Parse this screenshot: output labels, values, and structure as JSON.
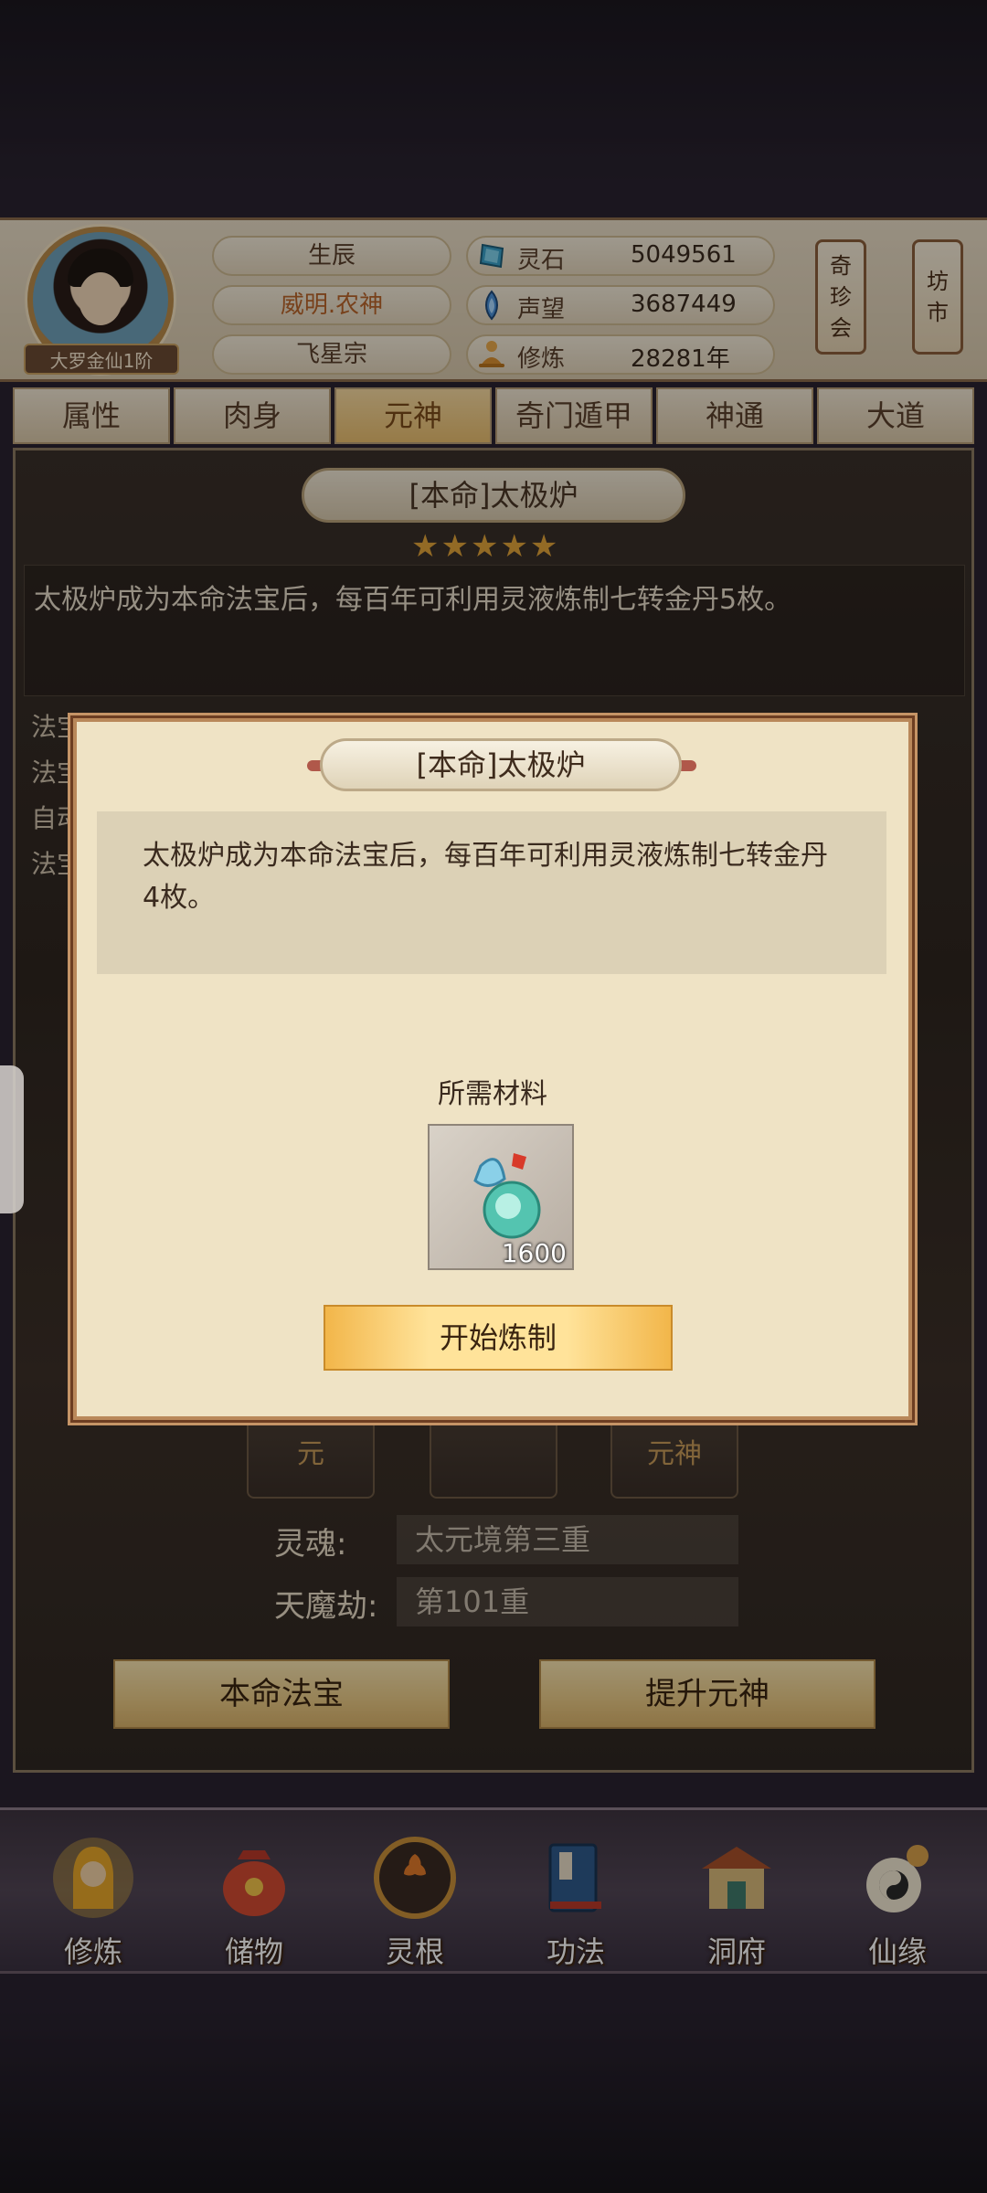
{
  "header": {
    "rank_badge": "大罗金仙1阶",
    "birth_label": "生辰",
    "title_name": "威明.农神",
    "sect": "飞星宗",
    "stats": [
      {
        "icon": "spirit-stone-icon",
        "label": "灵石",
        "value": "5049561"
      },
      {
        "icon": "reputation-icon",
        "label": "声望",
        "value": "3687449"
      },
      {
        "icon": "cultivation-icon",
        "label": "修炼",
        "value": "28281年"
      }
    ],
    "side_buttons": [
      {
        "label_lines": [
          "奇",
          "珍",
          "会"
        ]
      },
      {
        "label_lines": [
          "坊",
          "市"
        ]
      }
    ]
  },
  "tabs": [
    {
      "label": "属性",
      "active": false
    },
    {
      "label": "肉身",
      "active": false
    },
    {
      "label": "元神",
      "active": true
    },
    {
      "label": "奇门遁甲",
      "active": false
    },
    {
      "label": "神通",
      "active": false
    },
    {
      "label": "大道",
      "active": false
    }
  ],
  "background_panel": {
    "title": "[本命]太极炉",
    "stars": "★★★★★",
    "description": "太极炉成为本命法宝后，每百年可利用灵液炼制七转金丹5枚。",
    "left_texts": [
      "法宝成长 1/5000",
      "法宝",
      "自动",
      "法宝"
    ],
    "item_slots": [
      "元",
      "",
      "元神"
    ],
    "rows": [
      {
        "label": "灵魂:",
        "value": "太元境第三重"
      },
      {
        "label": "天魔劫:",
        "value": "第101重"
      }
    ],
    "buttons": [
      "本命法宝",
      "提升元神"
    ]
  },
  "modal": {
    "title": "[本命]太极炉",
    "description": "太极炉成为本命法宝后，每百年可利用灵液炼制七转金丹4枚。",
    "materials_label": "所需材料",
    "material": {
      "icon": "spirit-liquid-gourd-icon",
      "count": "1600"
    },
    "start_button": "开始炼制"
  },
  "bottom_nav": [
    {
      "label": "修炼",
      "icon": "cultivate-monk-icon"
    },
    {
      "label": "储物",
      "icon": "storage-bag-icon"
    },
    {
      "label": "灵根",
      "icon": "spirit-root-icon"
    },
    {
      "label": "功法",
      "icon": "technique-book-icon"
    },
    {
      "label": "洞府",
      "icon": "cave-mansion-icon"
    },
    {
      "label": "仙缘",
      "icon": "immortal-fate-icon"
    }
  ],
  "colors": {
    "active_tab": "#e8bd6e",
    "title_name": "#b8642a",
    "stars": "#e0a33a",
    "start_button": "#ffe39a"
  }
}
